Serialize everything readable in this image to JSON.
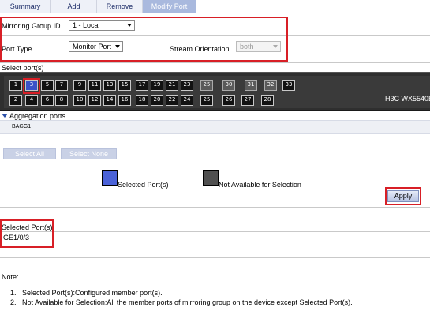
{
  "tabs": [
    {
      "label": "Summary",
      "active": false
    },
    {
      "label": "Add",
      "active": false
    },
    {
      "label": "Remove",
      "active": false
    },
    {
      "label": "Modify Port",
      "active": true
    }
  ],
  "form": {
    "mirroring_group_label": "Mirroring Group ID",
    "mirroring_group_value": "1 - Local",
    "port_type_label": "Port Type",
    "port_type_value": "Monitor Port",
    "stream_orientation_label": "Stream Orientation",
    "stream_orientation_value": "both"
  },
  "select_ports_label": "Select port(s)",
  "device": {
    "name": "H3C WX5540E",
    "top_ports": [
      "1",
      "3",
      "5",
      "7",
      "9",
      "11",
      "13",
      "15",
      "17",
      "19",
      "21",
      "23",
      "25",
      "30",
      "31",
      "32",
      "33"
    ],
    "bottom_ports": [
      "2",
      "4",
      "6",
      "8",
      "10",
      "12",
      "14",
      "16",
      "18",
      "20",
      "22",
      "24",
      "25",
      "26",
      "27",
      "28"
    ],
    "selected_port": "3"
  },
  "aggregation": {
    "title": "Aggregation ports",
    "items": [
      "BAGG1"
    ]
  },
  "buttons": {
    "select_all": "Select All",
    "select_none": "Select None",
    "apply": "Apply"
  },
  "legend": {
    "selected": "Selected Port(s)",
    "not_available": "Not Available for Selection",
    "selected_color": "#4a62d8",
    "not_available_color": "#505050"
  },
  "selected_ports_section": {
    "label": "Selected Port(s)",
    "value": "GE1/0/3"
  },
  "note": {
    "title": "Note:",
    "items": [
      {
        "num": "1.",
        "text": "Selected Port(s):Configured member port(s)."
      },
      {
        "num": "2.",
        "text": "Not Available for Selection:All the member ports of mirroring group on the device except Selected Port(s)."
      }
    ]
  },
  "colors": {
    "accent_red": "#d81f26",
    "tab_active": "#a9b9de"
  }
}
